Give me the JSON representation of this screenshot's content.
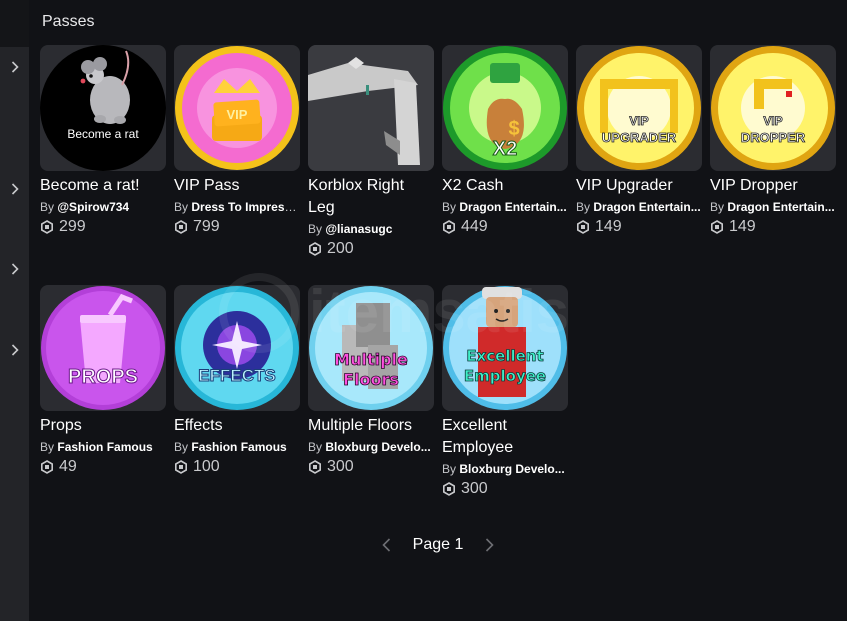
{
  "section": {
    "title": "Passes"
  },
  "colors": {
    "background": "#111216",
    "rail": "#232428",
    "card": "#2b2c31"
  },
  "passes": [
    {
      "name": "Become a rat!",
      "by": "By",
      "creator": "@Spirow734",
      "price": "299",
      "thumb_text": "Become a rat",
      "icon": "rat-thumbnail"
    },
    {
      "name": "VIP Pass",
      "by": "By",
      "creator": "Dress To Impress ...",
      "price": "799",
      "thumb_text": "VIP",
      "icon": "vip-pass-thumbnail"
    },
    {
      "name": "Korblox Right Leg",
      "by": "By",
      "creator": "@lianasugc",
      "price": "200",
      "thumb_text": "",
      "icon": "korblox-leg-thumbnail"
    },
    {
      "name": "X2 Cash",
      "by": "By",
      "creator": "Dragon Entertain...",
      "price": "449",
      "thumb_text": "X2",
      "icon": "x2-cash-thumbnail"
    },
    {
      "name": "VIP Upgrader",
      "by": "By",
      "creator": "Dragon Entertain...",
      "price": "149",
      "thumb_text": "VIP UPGRADER",
      "icon": "vip-upgrader-thumbnail"
    },
    {
      "name": "VIP Dropper",
      "by": "By",
      "creator": "Dragon Entertain...",
      "price": "149",
      "thumb_text": "VIP DROPPER",
      "icon": "vip-dropper-thumbnail"
    },
    {
      "name": "Props",
      "by": "By",
      "creator": "Fashion Famous",
      "price": "49",
      "thumb_text": "PROPS",
      "icon": "props-thumbnail"
    },
    {
      "name": "Effects",
      "by": "By",
      "creator": "Fashion Famous",
      "price": "100",
      "thumb_text": "EFFECTS",
      "icon": "effects-thumbnail"
    },
    {
      "name": "Multiple Floors",
      "by": "By",
      "creator": "Bloxburg Develo...",
      "price": "300",
      "thumb_text": "Multiple Floors",
      "icon": "multiple-floors-thumbnail"
    },
    {
      "name": "Excellent Employee",
      "by": "By",
      "creator": "Bloxburg Develo...",
      "price": "300",
      "thumb_text": "Excellent Employee",
      "icon": "excellent-employee-thumbnail"
    }
  ],
  "pager": {
    "label": "Page 1"
  },
  "watermark": {
    "text": "itemsatis"
  }
}
